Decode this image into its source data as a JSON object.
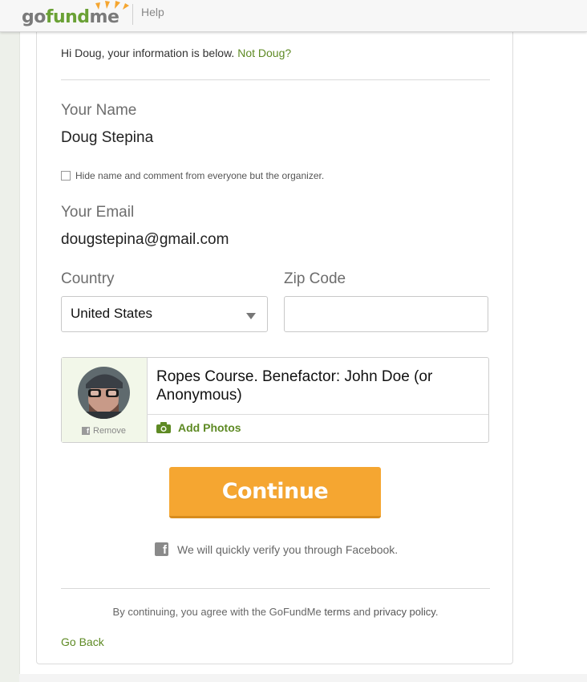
{
  "header": {
    "logo_go": "go",
    "logo_fund": "fund",
    "logo_me": "me",
    "help_label": "Help"
  },
  "greeting": {
    "text": "Hi Doug, your information is below.",
    "not_user_link": "Not Doug?"
  },
  "name": {
    "label": "Your Name",
    "value": "Doug Stepina"
  },
  "hide_option": {
    "label": "Hide name and comment from everyone but the organizer.",
    "checked": false
  },
  "email": {
    "label": "Your Email",
    "value": "dougstepina@gmail.com"
  },
  "country": {
    "label": "Country",
    "selected": "United States"
  },
  "zip": {
    "label": "Zip Code",
    "value": ""
  },
  "comment": {
    "text": "Ropes Course.  Benefactor: John Doe (or Anonymous)",
    "remove_label": "Remove",
    "add_photos_label": "Add Photos"
  },
  "actions": {
    "continue_label": "Continue",
    "verify_text": "We will quickly verify you through Facebook.",
    "go_back_label": "Go Back"
  },
  "terms": {
    "prefix": "By continuing, you agree with the GoFundMe",
    "terms_link": "terms",
    "and": "and",
    "privacy_link": "privacy policy",
    "suffix": "."
  },
  "colors": {
    "brand_green": "#5e8a24",
    "continue_orange": "#f5a631"
  },
  "icons": {
    "facebook": "facebook-icon",
    "camera": "camera-icon",
    "dropdown": "chevron-down-icon"
  }
}
